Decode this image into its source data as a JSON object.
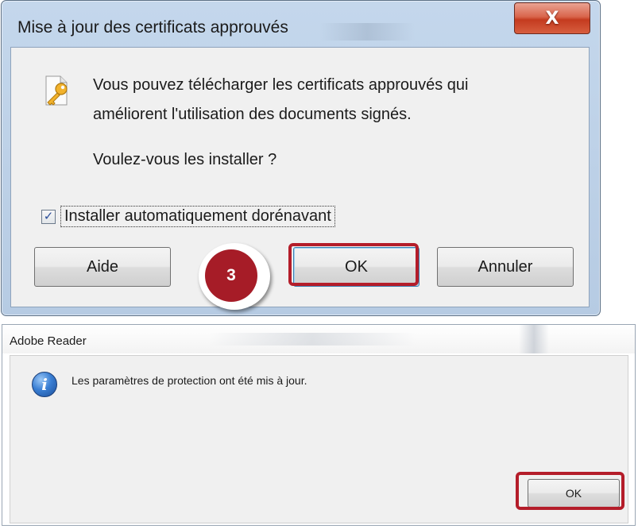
{
  "dialog_certificates": {
    "title": "Mise à jour des certificats approuvés",
    "close_label": "X",
    "message_line1": "Vous pouvez télécharger les certificats approuvés qui",
    "message_line2": "améliorent l'utilisation des documents signés.",
    "question": "Voulez-vous les installer ?",
    "checkbox": {
      "label": "Installer automatiquement dorénavant",
      "checked": true,
      "mark": "✓"
    },
    "buttons": {
      "help": "Aide",
      "ok": "OK",
      "cancel": "Annuler"
    },
    "step_badge": "3",
    "icon": "key-icon"
  },
  "dialog_adobe": {
    "title": "Adobe Reader",
    "message": "Les paramètres de protection ont été mis à jour.",
    "ok_button": "OK",
    "icon": "info-icon",
    "icon_glyph": "i"
  },
  "colors": {
    "highlight": "#b41d2a",
    "badge": "#a61c27",
    "close_button": "#c43b1f",
    "frame": "#b6cbe3"
  }
}
